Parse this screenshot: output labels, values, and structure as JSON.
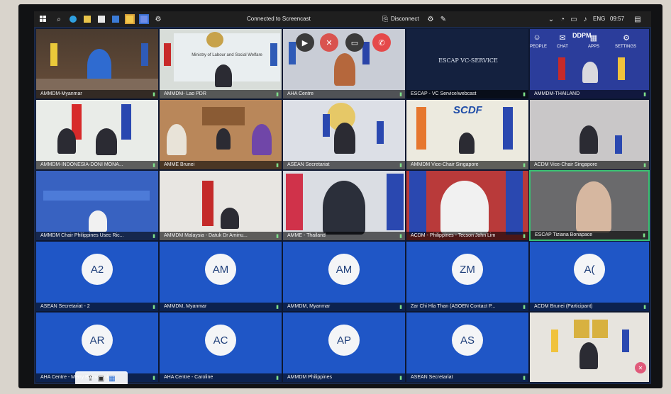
{
  "taskbar": {
    "cast_status": "Connected to Screencast",
    "disconnect_label": "Disconnect",
    "lang": "ENG",
    "time": "09:57"
  },
  "meeting_controls": {
    "people_label": "PEOPLE",
    "chat_label": "CHAT",
    "apps_label": "APPS",
    "settings_label": "SETTINGS"
  },
  "tiles": [
    {
      "label": "AMMDM-Myanmar"
    },
    {
      "label": "AMMDM- Lao PDR",
      "banner": "Ministry of Labour and Social Welfare"
    },
    {
      "label": "AHA Centre"
    },
    {
      "label": "ESCAP - VC Service/webcast",
      "screen_text": "ESCAP VC-SERVICE"
    },
    {
      "label": "AMMDM-THAILAND",
      "banner": "DDPM"
    },
    {
      "label": "AMMDM-INDONESIA-DONI MONA..."
    },
    {
      "label": "AMME Brunei"
    },
    {
      "label": "ASEAN Secretariat"
    },
    {
      "label": "AMMDM Vice-Chair Singapore",
      "banner": "SCDF"
    },
    {
      "label": "ACDM Vice-Chair Singapore"
    },
    {
      "label": "AMMDM Chair Philippines Usec Ric..."
    },
    {
      "label": "AMMDM Malaysia - Datuk Dr Aminu..."
    },
    {
      "label": "AMME - Thailand"
    },
    {
      "label": "ACDM - Philippines - Tecson John Lim"
    },
    {
      "label": "ESCAP Tiziana Bonapace"
    },
    {
      "label": "ASEAN Secretariat - 2",
      "initials": "A2"
    },
    {
      "label": "AMMDM, Myanmar",
      "initials": "AM"
    },
    {
      "label": "AMMDM, Myanmar",
      "initials": "AM"
    },
    {
      "label": "Zar Chi Hla Than (ASOEN Contact P...",
      "initials": "ZM"
    },
    {
      "label": "ACDM Brunei (Participant)",
      "initials": "A("
    },
    {
      "label": "AHA Centre - Merry Bismayani",
      "initials": "AR"
    },
    {
      "label": "AHA Centre - Caroline",
      "initials": "AC"
    },
    {
      "label": "AMMDM Philippines",
      "initials": "AP"
    },
    {
      "label": "ASEAN Secretariat",
      "initials": "AS"
    },
    {
      "label": ""
    }
  ],
  "colors": {
    "avatar_bg": "#1f56c6",
    "active_border": "#38c172",
    "asean_blue": "#1b3f9b"
  }
}
